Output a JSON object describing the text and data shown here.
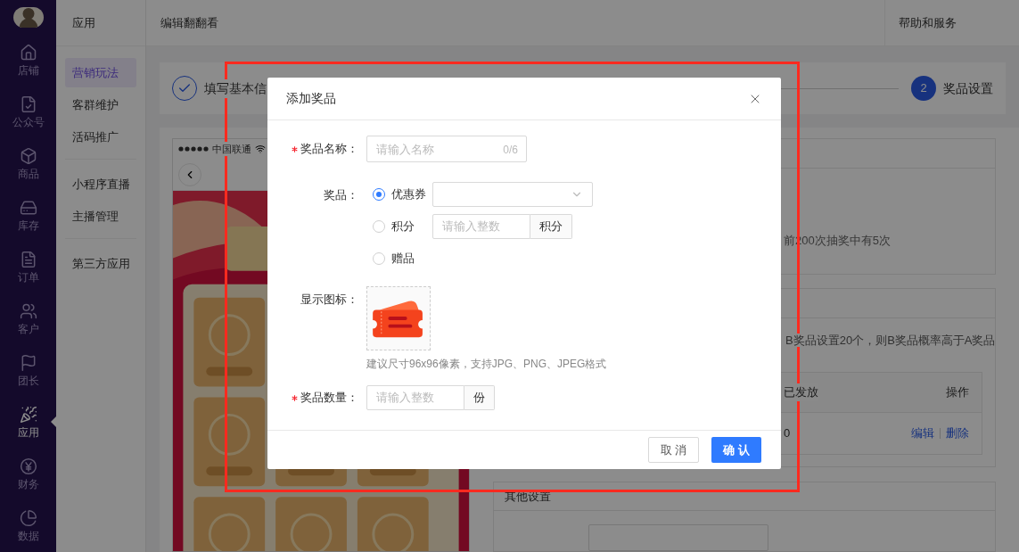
{
  "sidebar": {
    "items": [
      {
        "label": "店铺",
        "selected": false
      },
      {
        "label": "公众号",
        "selected": false
      },
      {
        "label": "商品",
        "selected": false
      },
      {
        "label": "库存",
        "selected": false
      },
      {
        "label": "订单",
        "selected": false
      },
      {
        "label": "客户",
        "selected": false
      },
      {
        "label": "团长",
        "selected": false
      },
      {
        "label": "应用",
        "selected": true
      },
      {
        "label": "财务",
        "selected": false
      },
      {
        "label": "数据",
        "selected": false
      }
    ]
  },
  "submenu": {
    "title": "应用",
    "groups": [
      [
        {
          "label": "营销玩法",
          "selected": true
        },
        {
          "label": "客群维护",
          "selected": false
        },
        {
          "label": "活码推广",
          "selected": false
        }
      ],
      [
        {
          "label": "小程序直播",
          "selected": false
        },
        {
          "label": "主播管理",
          "selected": false
        }
      ],
      [
        {
          "label": "第三方应用",
          "selected": false
        }
      ]
    ]
  },
  "header": {
    "title": "编辑翻翻看",
    "help": "帮助和服务"
  },
  "steps": [
    {
      "label": "填写基本信",
      "done": true
    },
    {
      "label": "奖品设置",
      "done": false,
      "number": "2"
    }
  ],
  "preview": {
    "carrier": "中国联通"
  },
  "panels": [
    {
      "kind": "text",
      "text": "前200次抽奖中有5次"
    },
    {
      "kind": "table",
      "text": "B奖品设置20个，则B奖品概率高于A奖品",
      "columns": [
        "已发放",
        "操作"
      ],
      "rows": [
        {
          "issued": "0",
          "actions": [
            "编辑",
            "删除"
          ]
        }
      ]
    },
    {
      "kind": "settings",
      "title": "其他设置"
    }
  ],
  "dialog": {
    "title": "添加奖品",
    "name": {
      "label": "奖品名称：",
      "required": true,
      "placeholder": "请输入名称",
      "counter": "0/6"
    },
    "prize": {
      "label": "奖品：",
      "required": false,
      "options": [
        {
          "label": "优惠券",
          "selected": true,
          "kind": "select"
        },
        {
          "label": "积分",
          "selected": false,
          "kind": "number",
          "placeholder": "请输入整数",
          "unit": "积分"
        },
        {
          "label": "赠品",
          "selected": false,
          "kind": "plain"
        }
      ]
    },
    "icon": {
      "label": "显示图标：",
      "required": false,
      "hint": "建议尺寸96x96像素，支持JPG、PNG、JPEG格式"
    },
    "quantity": {
      "label": "奖品数量：",
      "required": true,
      "placeholder": "请输入整数",
      "unit": "份"
    },
    "buttons": [
      {
        "label": "取 消",
        "kind": "secondary"
      },
      {
        "label": "确 认",
        "kind": "primary"
      }
    ]
  }
}
